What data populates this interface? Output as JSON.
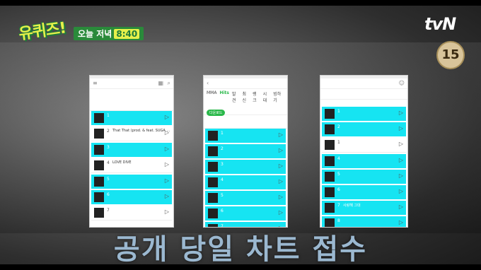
{
  "overlay": {
    "show_logo": "유퀴즈!",
    "schedule_label": "오늘 저녁",
    "schedule_time": "8:40",
    "network": "tvN",
    "age_rating": "15",
    "caption": "공개 당일 차트 접수"
  },
  "phone1": {
    "rows": [
      {
        "rank": "1",
        "style": "cy"
      },
      {
        "rank": "2",
        "style": "wh",
        "title": "That That (prod. & feat. SUGA ..."
      },
      {
        "rank": "3",
        "style": "cy"
      },
      {
        "rank": "4",
        "style": "wh",
        "title": "LOVE DIVE"
      },
      {
        "rank": "5",
        "style": "cy"
      },
      {
        "rank": "6",
        "style": "cy"
      },
      {
        "rank": "7",
        "style": "wh"
      }
    ]
  },
  "phone2": {
    "tabs": [
      "MMA",
      "Hits",
      "발견",
      "최신",
      "랭크",
      "시대",
      "빙하기"
    ],
    "pill": "다운로드",
    "rows": [
      {
        "rank": "1"
      },
      {
        "rank": "2"
      },
      {
        "rank": "3"
      },
      {
        "rank": "4"
      },
      {
        "rank": "5"
      },
      {
        "rank": "6"
      },
      {
        "rank": "7"
      }
    ]
  },
  "phone3": {
    "rows": [
      {
        "rank": "1",
        "style": "cy"
      },
      {
        "rank": "2",
        "style": "cy"
      },
      {
        "rank": "1",
        "style": "wh"
      },
      {
        "rank": "4",
        "style": "cy"
      },
      {
        "rank": "5",
        "style": "cy"
      },
      {
        "rank": "6",
        "style": "cy"
      },
      {
        "rank": "7",
        "style": "cy",
        "title": "사랑해 그대"
      },
      {
        "rank": "8",
        "style": "cy"
      }
    ]
  },
  "colors": {
    "accent": "#16e4f2",
    "logo": "#e6f04a",
    "green": "#2ab84a"
  }
}
